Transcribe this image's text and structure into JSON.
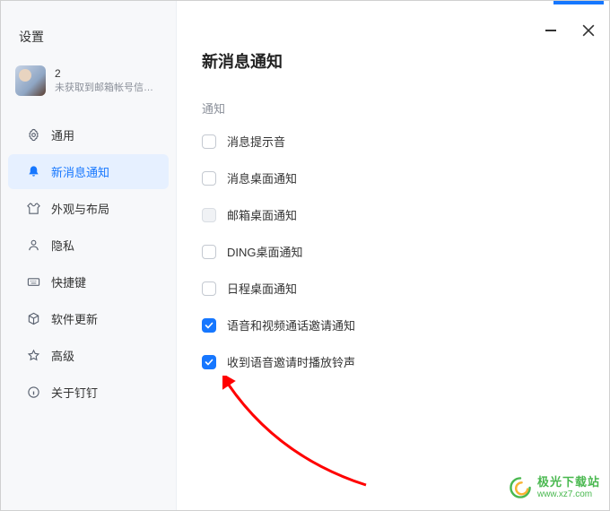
{
  "window": {
    "title": "设置",
    "profile": {
      "name": "2",
      "subtitle": "未获取到邮箱帐号信息..."
    }
  },
  "sidebar": {
    "items": [
      {
        "label": "通用",
        "icon": "gear-icon",
        "active": false
      },
      {
        "label": "新消息通知",
        "icon": "bell-icon",
        "active": true
      },
      {
        "label": "外观与布局",
        "icon": "shirt-icon",
        "active": false
      },
      {
        "label": "隐私",
        "icon": "person-icon",
        "active": false
      },
      {
        "label": "快捷键",
        "icon": "keyboard-icon",
        "active": false
      },
      {
        "label": "软件更新",
        "icon": "package-icon",
        "active": false
      },
      {
        "label": "高级",
        "icon": "star-icon",
        "active": false
      },
      {
        "label": "关于钉钉",
        "icon": "info-icon",
        "active": false
      }
    ]
  },
  "main": {
    "title": "新消息通知",
    "section_label": "通知",
    "options": [
      {
        "label": "消息提示音",
        "checked": false,
        "disabled": false
      },
      {
        "label": "消息桌面通知",
        "checked": false,
        "disabled": false
      },
      {
        "label": "邮箱桌面通知",
        "checked": false,
        "disabled": true
      },
      {
        "label": "DING桌面通知",
        "checked": false,
        "disabled": false
      },
      {
        "label": "日程桌面通知",
        "checked": false,
        "disabled": false
      },
      {
        "label": "语音和视频通话邀请通知",
        "checked": true,
        "disabled": false
      },
      {
        "label": "收到语音邀请时播放铃声",
        "checked": true,
        "disabled": false
      }
    ]
  },
  "annotation": {
    "type": "arrow",
    "color": "#ff0000"
  },
  "watermark": {
    "cn": "极光下载站",
    "url": "www.xz7.com"
  },
  "colors": {
    "accent": "#1677ff",
    "sidebar_active_bg": "#e6f0ff",
    "success": "#49b84f"
  }
}
